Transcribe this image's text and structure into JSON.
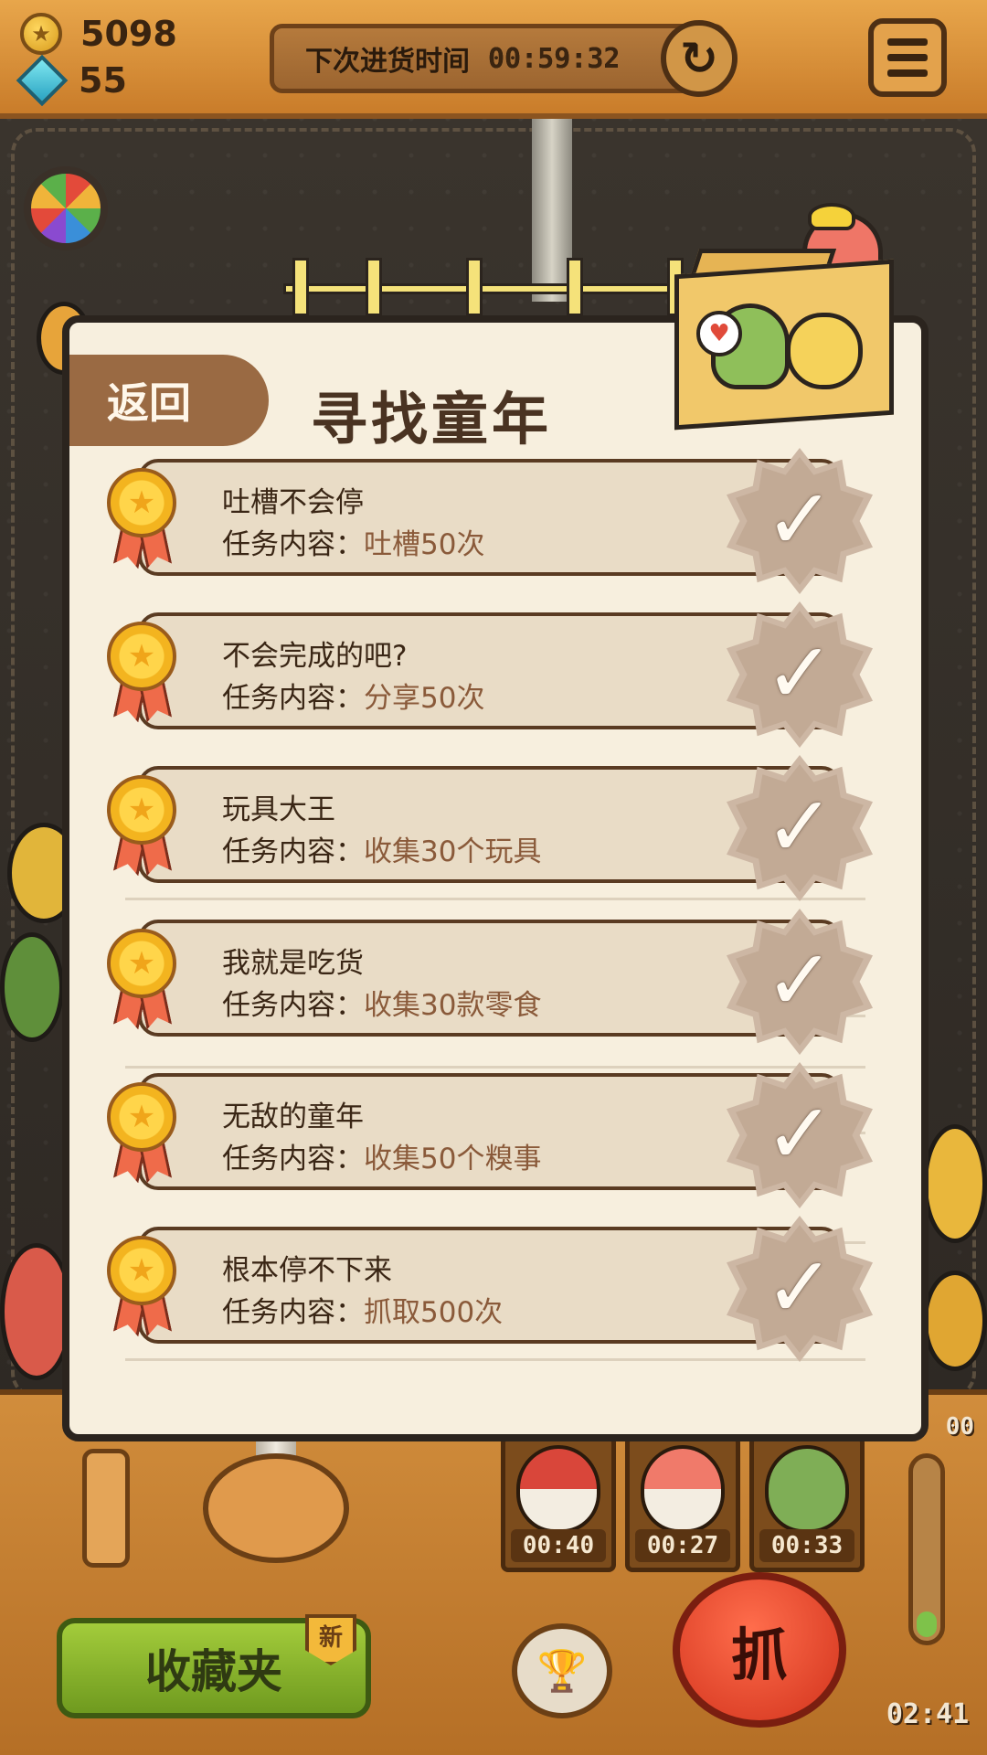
{
  "currency": {
    "coins": "5098",
    "gems": "55"
  },
  "restock": {
    "label": "下次进货时间",
    "time": "00:59:32"
  },
  "modal": {
    "back_label": "返回",
    "title": "寻找童年",
    "desc_prefix": "任务内容：",
    "tasks": [
      {
        "title": "吐槽不会停",
        "content": "吐槽50次",
        "completed": true
      },
      {
        "title": "不会完成的吧?",
        "content": "分享50次",
        "completed": true
      },
      {
        "title": "玩具大王",
        "content": "收集30个玩具",
        "completed": true
      },
      {
        "title": "我就是吃货",
        "content": "收集30款零食",
        "completed": true
      },
      {
        "title": "无敌的童年",
        "content": "收集50个糗事",
        "completed": true
      },
      {
        "title": "根本停不下来",
        "content": "抓取500次",
        "completed": true
      }
    ]
  },
  "bottom": {
    "prize_timers": [
      "00:40",
      "00:27",
      "00:33"
    ],
    "collection_label": "收藏夹",
    "new_badge": "新",
    "grab_label": "抓",
    "round_timer": "02:41",
    "partial_timer": "00"
  },
  "colors": {
    "accent": "#9a6a43",
    "panel_bg": "#f7efde",
    "card_bg": "#e9dcc6",
    "check_badge": "#cdb7a4"
  }
}
